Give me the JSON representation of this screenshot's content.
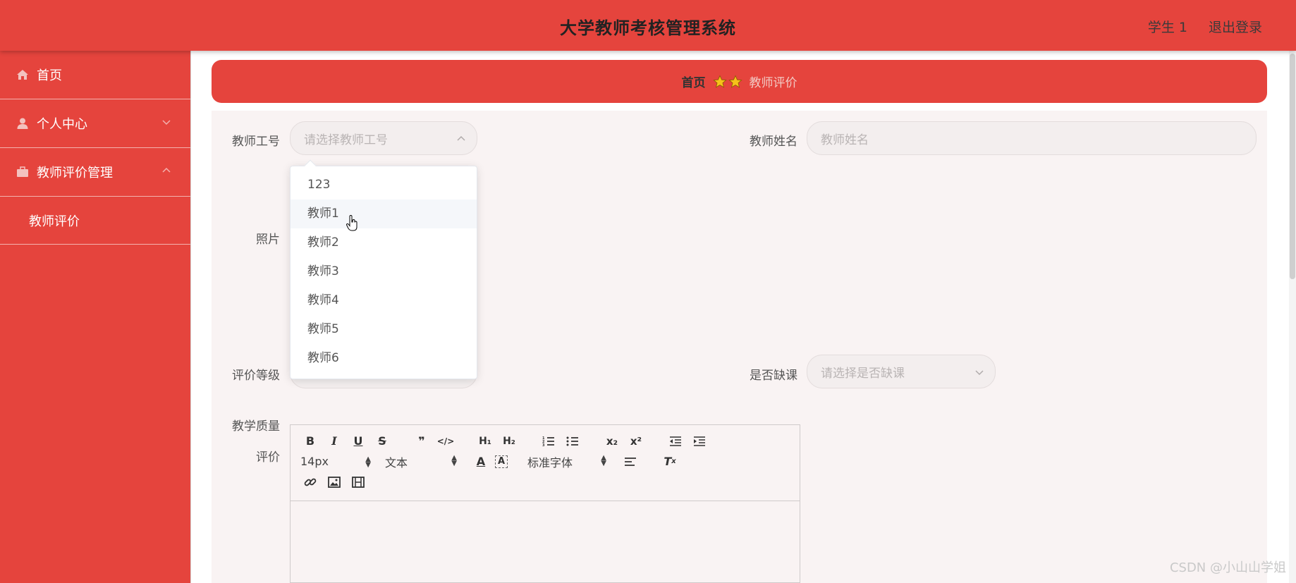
{
  "header": {
    "title": "大学教师考核管理系统",
    "user": "学生 1",
    "logout": "退出登录"
  },
  "sidebar": {
    "items": [
      {
        "label": "首页",
        "icon": "home-icon"
      },
      {
        "label": "个人中心",
        "icon": "user-icon"
      },
      {
        "label": "教师评价管理",
        "icon": "briefcase-icon"
      }
    ],
    "subitem": "教师评价"
  },
  "breadcrumb": {
    "home": "首页",
    "current": "教师评价"
  },
  "form": {
    "teacher_id_label": "教师工号",
    "teacher_id_placeholder": "请选择教师工号",
    "teacher_name_label": "教师姓名",
    "teacher_name_placeholder": "教师姓名",
    "photo_label": "照片",
    "grade_label": "评价等级",
    "absent_label": "是否缺课",
    "absent_placeholder": "请选择是否缺课",
    "quality_label": "教学质量",
    "comment_label": "评价"
  },
  "dropdown": {
    "options": [
      "123",
      "教师1",
      "教师2",
      "教师3",
      "教师4",
      "教师5",
      "教师6"
    ],
    "hovered_index": 1
  },
  "editor": {
    "size": "14px",
    "format": "文本",
    "font": "标准字体"
  },
  "watermark": "CSDN @小山山学姐",
  "colors": {
    "primary": "#e5443d",
    "form_bg": "#f9f3f3"
  }
}
